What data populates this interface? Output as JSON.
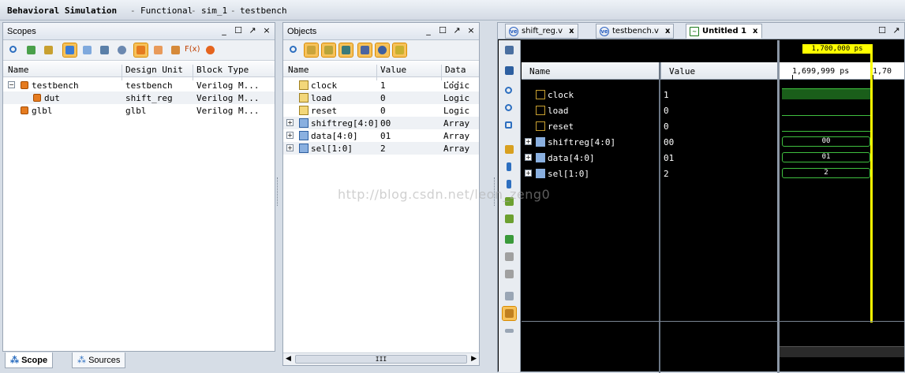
{
  "title": {
    "app": "Behavioral Simulation",
    "mode": "Functional",
    "sim": "sim_1",
    "top": "testbench"
  },
  "scopes": {
    "title": "Scopes",
    "columns": [
      "Name",
      "Design Unit",
      "Block Type"
    ],
    "rows": [
      {
        "name": "testbench",
        "unit": "testbench",
        "type": "Verilog M..."
      },
      {
        "name": "dut",
        "unit": "shift_reg",
        "type": "Verilog M..."
      },
      {
        "name": "glbl",
        "unit": "glbl",
        "type": "Verilog M..."
      }
    ],
    "tabs": [
      "Scope",
      "Sources"
    ],
    "toolbar_fx": "F(x)"
  },
  "objects": {
    "title": "Objects",
    "columns": [
      "Name",
      "Value",
      "Data ..."
    ],
    "rows": [
      {
        "name": "clock",
        "value": "1",
        "type": "Logic"
      },
      {
        "name": "load",
        "value": "0",
        "type": "Logic"
      },
      {
        "name": "reset",
        "value": "0",
        "type": "Logic"
      },
      {
        "name": "shiftreg[4:0]",
        "value": "00",
        "type": "Array"
      },
      {
        "name": "data[4:0]",
        "value": "01",
        "type": "Array"
      },
      {
        "name": "sel[1:0]",
        "value": "2",
        "type": "Array"
      }
    ],
    "scroll_mark": "III"
  },
  "wave": {
    "tabs": [
      {
        "label": "shift_reg.v",
        "close": "x"
      },
      {
        "label": "testbench.v",
        "close": "x"
      },
      {
        "label": "Untitled 1",
        "close": "x"
      }
    ],
    "columns": [
      "Name",
      "Value"
    ],
    "cursor_time": "1,700,000 ps",
    "ruler_start": "1,699,999 ps",
    "ruler_next": "1,70",
    "signals": [
      {
        "name": "clock",
        "value": "1"
      },
      {
        "name": "load",
        "value": "0"
      },
      {
        "name": "reset",
        "value": "0"
      },
      {
        "name": "shiftreg[4:0]",
        "value": "00",
        "bus": "00"
      },
      {
        "name": "data[4:0]",
        "value": "01",
        "bus": "01"
      },
      {
        "name": "sel[1:0]",
        "value": "2",
        "bus": "2"
      }
    ]
  },
  "watermark": "http://blog.csdn.net/leon_zeng0",
  "colors": {
    "wave_green": "#3fbf3f",
    "cursor_yellow": "#ffff00",
    "highlight_orange": "#f7c25a"
  }
}
